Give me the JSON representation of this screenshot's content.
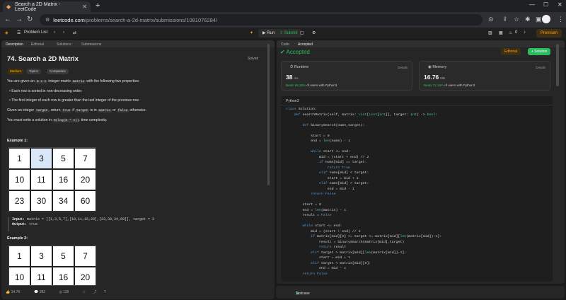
{
  "browser": {
    "tab_title": "Search a 2D Matrix - LeetCode",
    "url_host": "leetcode.com",
    "url_path": "/problems/search-a-2d-matrix/submissions/1081076284/"
  },
  "header": {
    "problem_list": "Problem List",
    "run": "Run",
    "submit": "Submit",
    "streak": "0",
    "premium": "Premium"
  },
  "left": {
    "tabs": [
      "Description",
      "Editorial",
      "Solutions",
      "Submissions"
    ],
    "title": "74. Search a 2D Matrix",
    "status": "Solved",
    "chips": [
      "Medium",
      "Topics",
      "Companies"
    ],
    "desc1_pre": "You are given an ",
    "desc1_code1": "m x n",
    "desc1_mid": " integer matrix ",
    "desc1_code2": "matrix",
    "desc1_post": " with the following two properties:",
    "bullet1": "Each row is sorted in non-decreasing order.",
    "bullet2": "The first integer of each row is greater than the last integer of the previous row.",
    "desc2_pre": "Given an integer ",
    "desc2_c1": "target",
    "desc2_a": ", return ",
    "desc2_c2": "true",
    "desc2_b": " if ",
    "desc2_c3": "target",
    "desc2_c": " is in ",
    "desc2_c4": "matrix",
    "desc2_d": " or ",
    "desc2_c5": "false",
    "desc2_e": " otherwise.",
    "desc3_pre": "You must write a solution in ",
    "desc3_code": "O(log(m * n))",
    "desc3_post": " time complexity.",
    "example1": "Example 1:",
    "matrix1": [
      [
        "1",
        "3",
        "5",
        "7"
      ],
      [
        "10",
        "11",
        "16",
        "20"
      ],
      [
        "23",
        "30",
        "34",
        "60"
      ]
    ],
    "input_label": "Input:",
    "input_value": " matrix = [[1,3,5,7],[10,11,16,20],[23,30,34,60]], target = 3",
    "output_label": "Output:",
    "output_value": " true",
    "example2": "Example 2:",
    "matrix2": [
      [
        "1",
        "3",
        "5",
        "7"
      ],
      [
        "10",
        "11",
        "16",
        "20"
      ]
    ],
    "likes": "14.7K",
    "dislikes": "382",
    "comments": "118"
  },
  "right": {
    "tabs": [
      "Code",
      "Accepted"
    ],
    "accepted": "Accepted",
    "editorial": "Editorial",
    "solution": "+ Solution",
    "runtime_label": "Runtime",
    "runtime_value": "38",
    "runtime_unit": "ms",
    "runtime_beats_pct": "Beats 98.38%",
    "runtime_beats_rest": " of users with Python3",
    "memory_label": "Memory",
    "memory_value": "16.76",
    "memory_unit": "MB",
    "memory_beats_pct": "Beats 72.18%",
    "memory_beats_rest": " of users with Python3",
    "details": "Details",
    "lang": "Python3",
    "testcase": "Testcase"
  },
  "code_lines": [
    "class Solution:",
    "    def searchMatrix(self, matrix: List[List[int]], target: int) -> bool:",
    "",
    "        def binarySearch(nums,target):",
    "",
    "            start = 0",
    "            end = len(nums) - 1",
    "",
    "            while start <= end:",
    "                mid = (start + end) // 2",
    "                if nums[mid] == target:",
    "                    return True",
    "                elif nums[mid] < target:",
    "                    start = mid + 1",
    "                elif nums[mid] > target:",
    "                    end = mid - 1",
    "            return False",
    "",
    "        start = 0",
    "        end = len(matrix) - 1",
    "        result = False",
    "",
    "        while start <= end:",
    "            mid = (start + end) // 2",
    "            if matrix[mid][0] <= target <= matrix[mid][len(matrix[mid])-1]:",
    "                result = binarySearch(matrix[mid],target)",
    "                return result",
    "            elif target > matrix[mid][len(matrix[mid])-1]:",
    "                start = mid + 1",
    "            elif target < matrix[mid][0]:",
    "                end = mid - 1",
    "        return False"
  ],
  "colors": {
    "accent_green": "#2cbb5d",
    "accent_orange": "#ffa116",
    "highlight_cell": "#d9e7f8"
  }
}
